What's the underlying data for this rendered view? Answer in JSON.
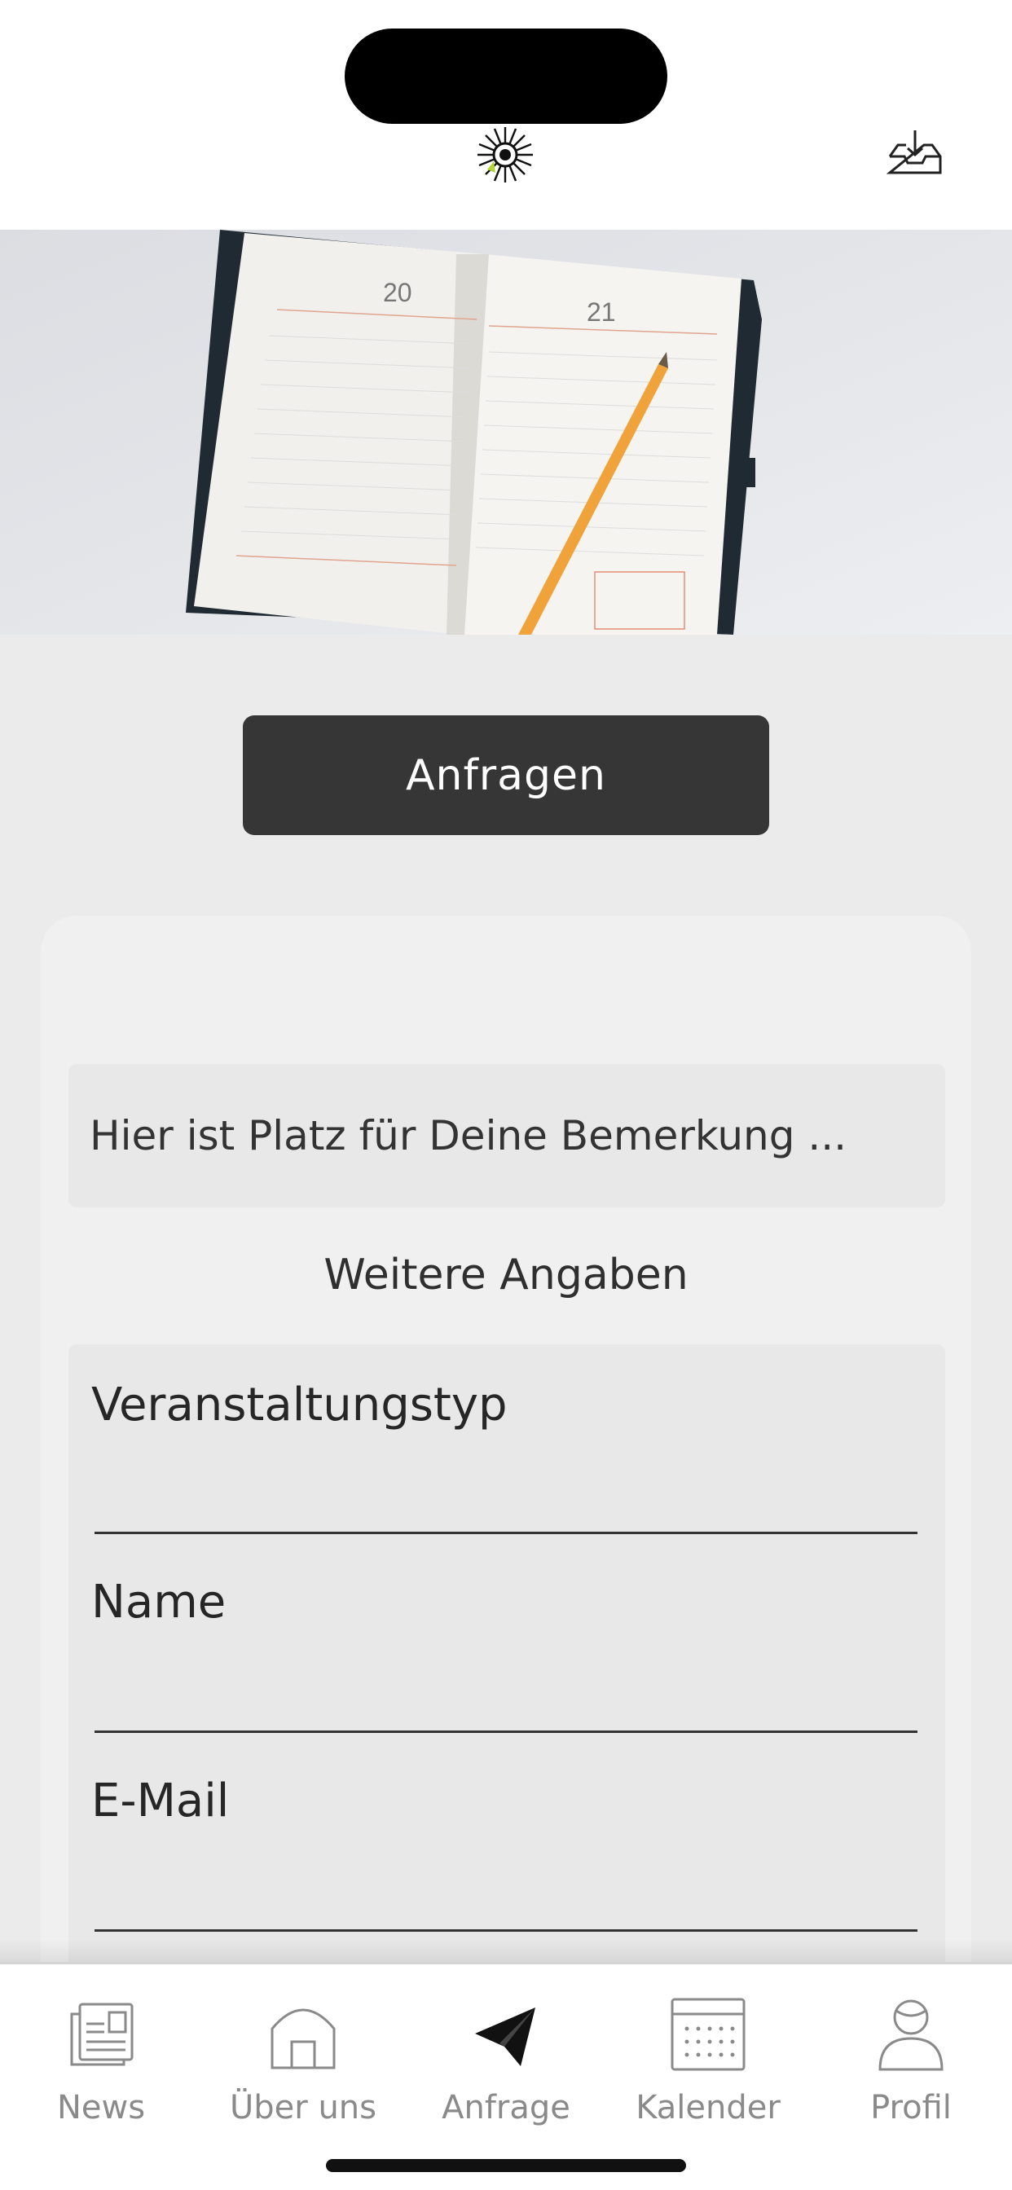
{
  "header": {
    "logo_icon": "sun-flower-logo-icon",
    "inbox_icon": "inbox-download-icon"
  },
  "hero": {
    "image": "open-planner-notebook-with-pencil",
    "page_numbers": [
      "20",
      "21"
    ]
  },
  "main": {
    "request_button": "Anfragen",
    "remark_placeholder": "Hier ist Platz für Deine Bemerkung ...",
    "section_title": "Weitere Angaben",
    "fields": [
      {
        "label": "Veranstaltungstyp",
        "value": ""
      },
      {
        "label": "Name",
        "value": ""
      },
      {
        "label": "E-Mail",
        "value": ""
      }
    ]
  },
  "tabbar": {
    "items": [
      {
        "label": "News",
        "icon": "newspaper-icon",
        "active": false
      },
      {
        "label": "Über uns",
        "icon": "home-icon",
        "active": false
      },
      {
        "label": "Anfrage",
        "icon": "paper-plane-icon",
        "active": true
      },
      {
        "label": "Kalender",
        "icon": "calendar-icon",
        "active": false
      },
      {
        "label": "Profil",
        "icon": "user-icon",
        "active": false
      }
    ]
  },
  "colors": {
    "button_bg": "#363636",
    "background": "#ebebeb",
    "card": "#f0f0f0",
    "tab_inactive": "#8a8a8a",
    "tab_active": "#1a1a1a"
  }
}
